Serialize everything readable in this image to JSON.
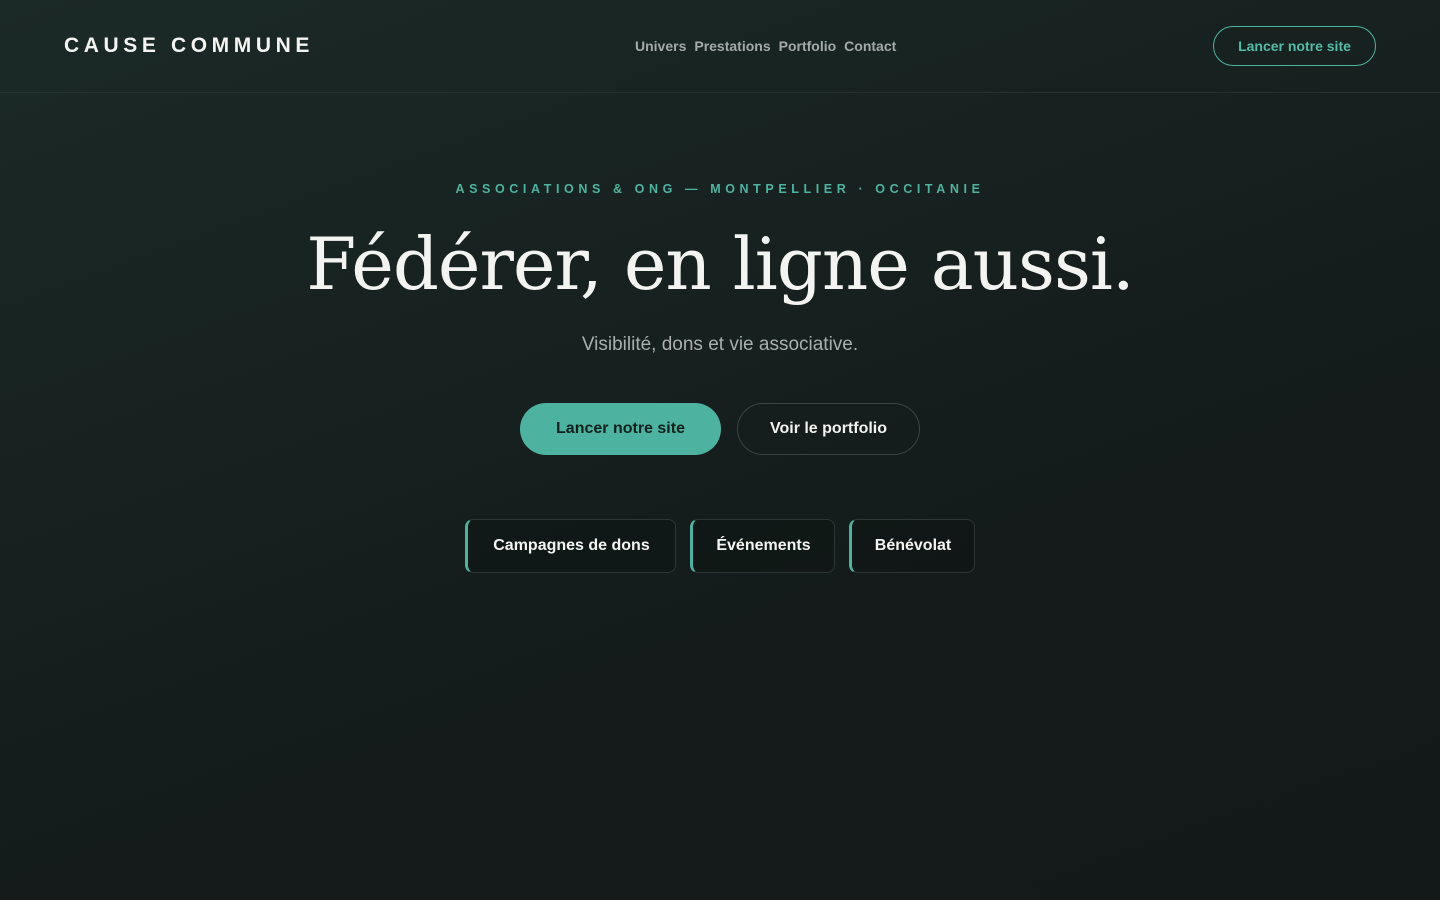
{
  "header": {
    "logo": "CAUSE COMMUNE",
    "nav": [
      "Univers",
      "Prestations",
      "Portfolio",
      "Contact"
    ],
    "cta_label": "Lancer notre site"
  },
  "hero": {
    "eyebrow": "ASSOCIATIONS & ONG — MONTPELLIER · OCCITANIE",
    "title": "Fédérer, en ligne aussi.",
    "subtitle": "Visibilité, dons et vie associative.",
    "primary_label": "Lancer notre site",
    "secondary_label": "Voir le portfolio"
  },
  "chips": [
    "Campagnes de dons",
    "Événements",
    "Bénévolat"
  ],
  "colors": {
    "accent": "#4db3a0",
    "background": "#141a1a",
    "text": "#f3f3f1",
    "muted": "#a3aaa8"
  }
}
